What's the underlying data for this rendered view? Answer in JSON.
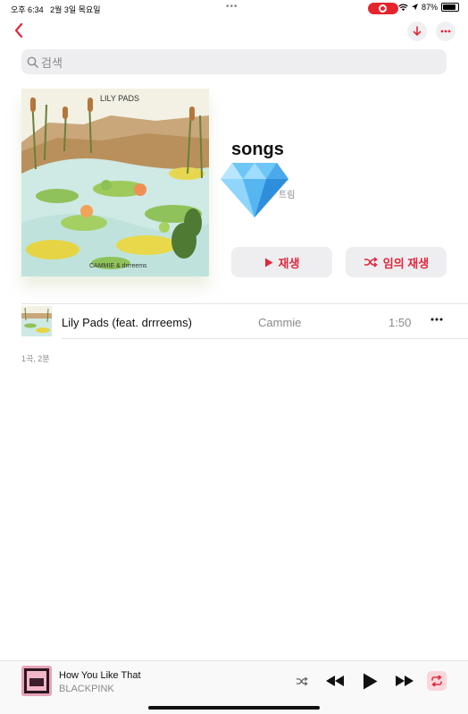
{
  "status": {
    "time": "오후 6:34",
    "date": "2월 3일 목요일",
    "battery": "87%",
    "battery_level": 0.87
  },
  "search": {
    "placeholder": "검색"
  },
  "artwork": {
    "text_title": "LILY PADS",
    "text_credit": "CAMMIE & drrreems"
  },
  "playlist": {
    "title": "songs",
    "subtitle": "트림",
    "play_label": "재생",
    "shuffle_label": "임의 재생"
  },
  "tracks": [
    {
      "title": "Lily Pads (feat. drrreems)",
      "artist": "Cammie",
      "duration": "1:50"
    }
  ],
  "summary": "1곡, 2분",
  "now_playing": {
    "title": "How You Like That",
    "artist": "BLACKPINK"
  },
  "colors": {
    "accent": "#e0283e",
    "record": "#e5252d",
    "button_bg": "#eeeef0"
  }
}
